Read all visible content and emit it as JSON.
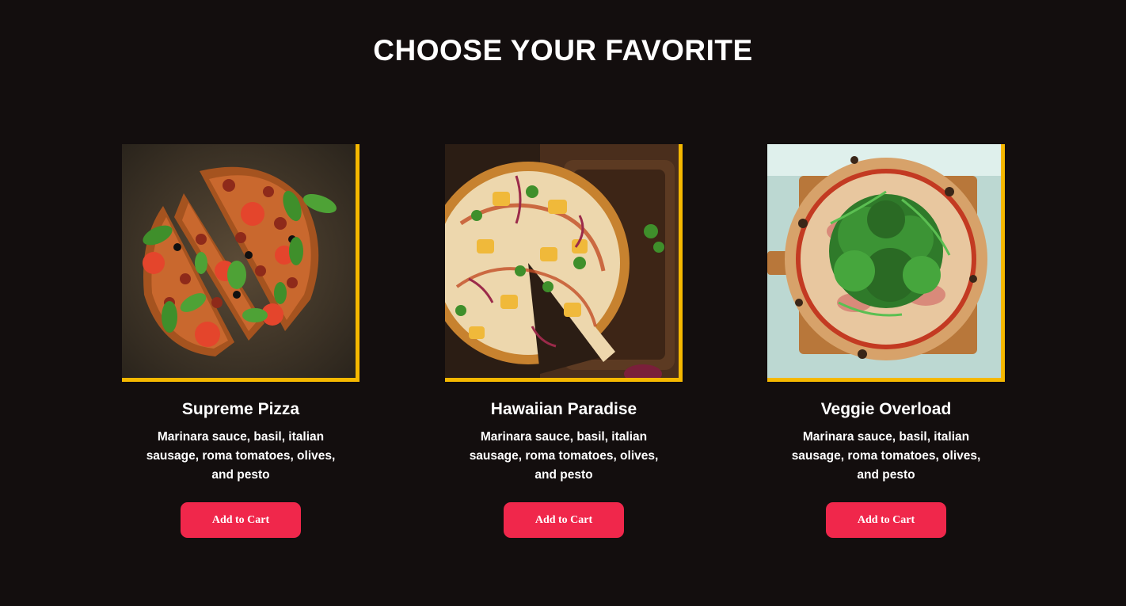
{
  "section": {
    "title": "CHOOSE YOUR FAVORITE"
  },
  "products": [
    {
      "name": "Supreme Pizza",
      "description": "Marinara sauce, basil, italian sausage, roma tomatoes, olives, and pesto",
      "button_label": "Add to Cart"
    },
    {
      "name": "Hawaiian Paradise",
      "description": "Marinara sauce, basil, italian sausage, roma tomatoes, olives, and pesto",
      "button_label": "Add to Cart"
    },
    {
      "name": "Veggie Overload",
      "description": "Marinara sauce, basil, italian sausage, roma tomatoes, olives, and pesto",
      "button_label": "Add to Cart"
    }
  ],
  "colors": {
    "background": "#130e0e",
    "accent_border": "#f5b800",
    "button": "#f0274b",
    "text": "#ffffff"
  }
}
